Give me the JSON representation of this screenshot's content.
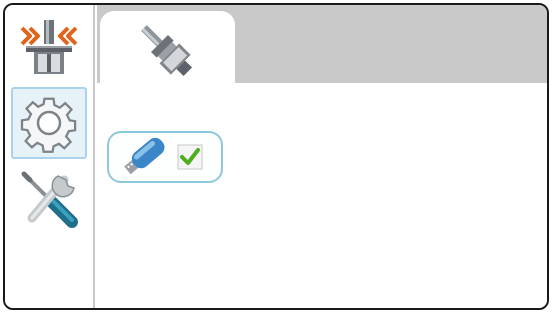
{
  "sidebar": {
    "items": [
      {
        "icon": "clamp-press-icon",
        "active": false
      },
      {
        "icon": "gear-icon",
        "active": true
      },
      {
        "icon": "wrench-screwdriver-icon",
        "active": false
      }
    ]
  },
  "tabs": [
    {
      "icon": "tool-holder-icon",
      "selected": true
    }
  ],
  "content": {
    "device": {
      "icon": "usb-drive-icon",
      "status_icon": "checkmark-icon",
      "connected": true
    }
  },
  "colors": {
    "accent": "#a9d3ea",
    "tabbar": "#c9c9c9",
    "check": "#4caf1f",
    "usb": "#3a86c8"
  }
}
